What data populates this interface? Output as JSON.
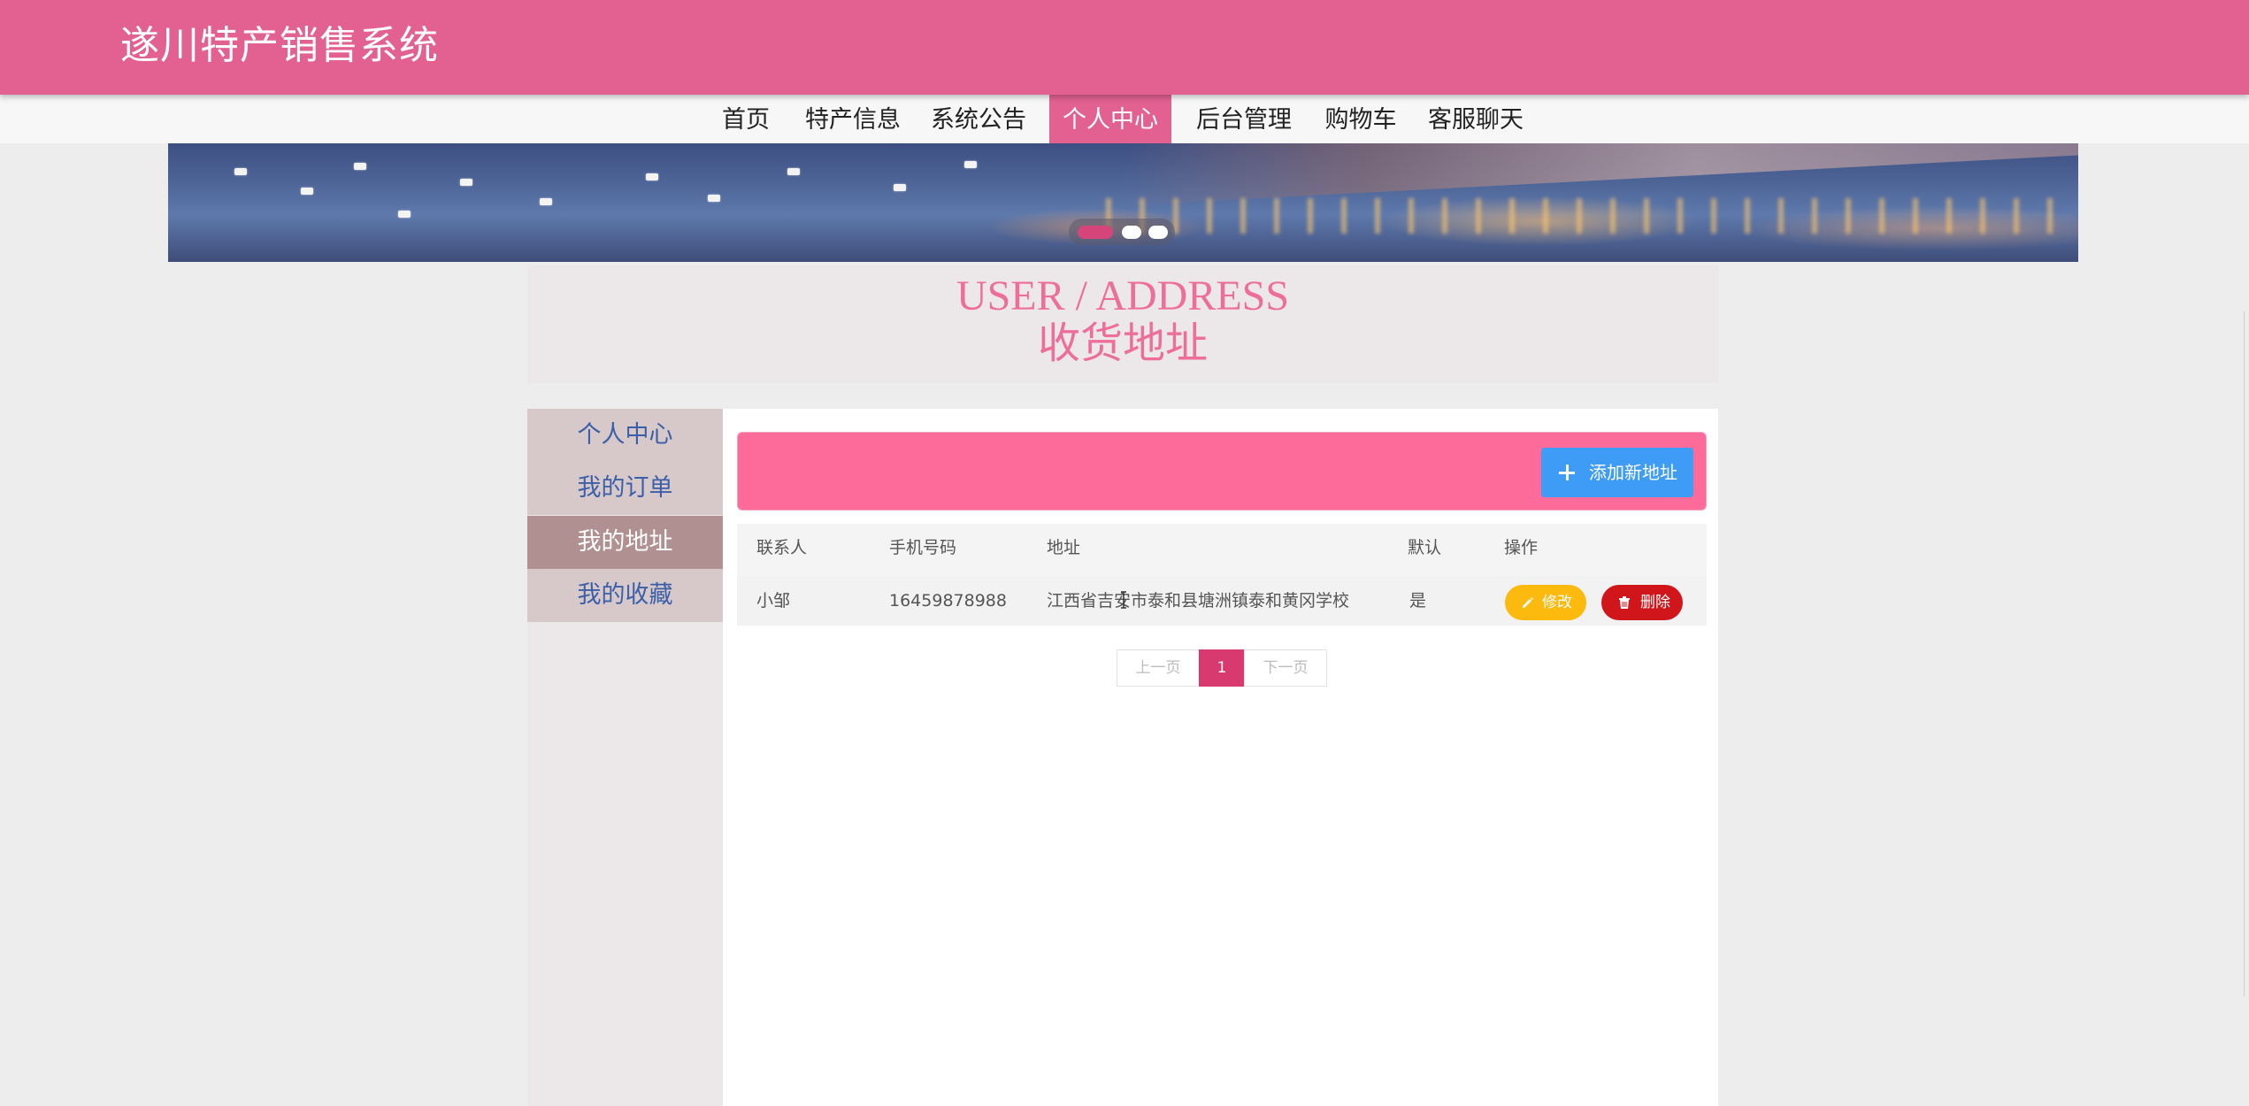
{
  "app": {
    "title": "遂川特产销售系统"
  },
  "nav": {
    "items": [
      {
        "label": "首页"
      },
      {
        "label": "特产信息"
      },
      {
        "label": "系统公告"
      },
      {
        "label": "个人中心",
        "active": true
      },
      {
        "label": "后台管理"
      },
      {
        "label": "购物车"
      },
      {
        "label": "客服聊天"
      }
    ]
  },
  "carousel": {
    "slides": 3,
    "active_index": 0
  },
  "heading": {
    "en": "USER / ADDRESS",
    "cn": "收货地址"
  },
  "sidebar": {
    "items": [
      {
        "label": "个人中心"
      },
      {
        "label": "我的订单"
      },
      {
        "label": "我的地址",
        "active": true
      },
      {
        "label": "我的收藏"
      }
    ]
  },
  "toolbar": {
    "add_label": "添加新地址"
  },
  "table": {
    "headers": [
      "联系人",
      "手机号码",
      "地址",
      "默认",
      "操作"
    ],
    "rows": [
      {
        "contact": "小邹",
        "phone": "16459878988",
        "address": "江西省吉安市泰和县塘洲镇泰和黄冈学校",
        "default": "是",
        "edit_label": "修改",
        "delete_label": "删除"
      }
    ]
  },
  "pagination": {
    "prev": "上一页",
    "current": "1",
    "next": "下一页"
  },
  "colors": {
    "header": "#e26190",
    "accent_pink": "#fd6b9a",
    "add_button": "#3f9cf6",
    "edit_button": "#fcb90e",
    "delete_button": "#d1161b",
    "active_sidebar": "#b09090"
  },
  "icons": {
    "add": "plus-icon",
    "edit": "pencil-icon",
    "delete": "trash-icon"
  }
}
